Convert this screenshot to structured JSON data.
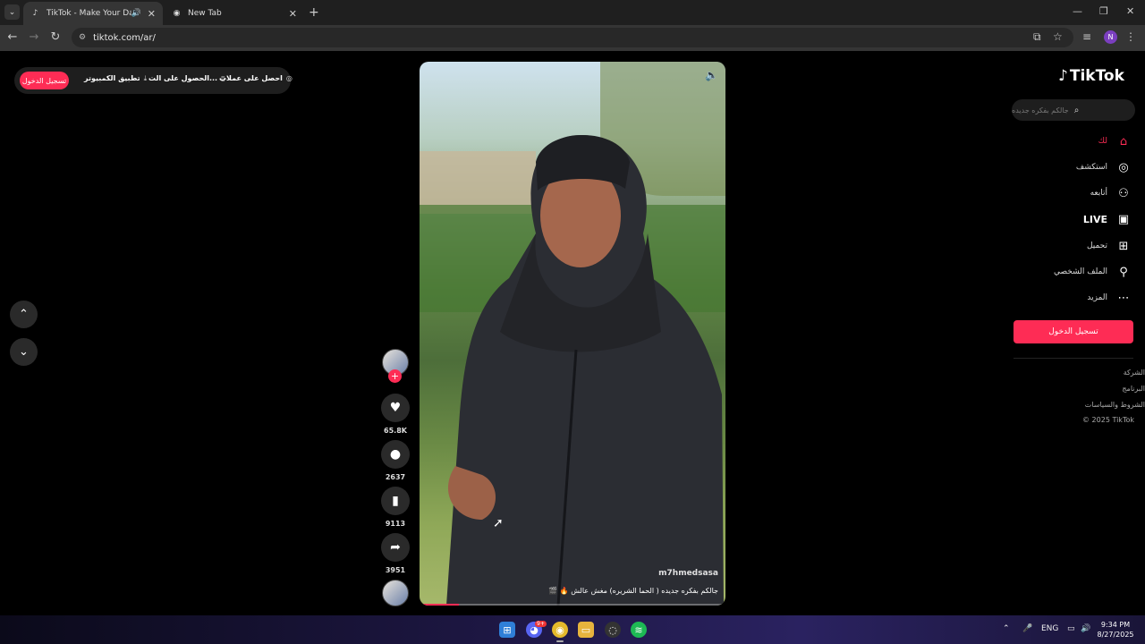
{
  "browser": {
    "tabs": [
      {
        "title": "TikTok - Make Your Day",
        "active": true
      },
      {
        "title": "New Tab",
        "active": false
      }
    ],
    "url": "tiktok.com/ar/",
    "profile_initial": "N"
  },
  "topbar": {
    "login": "تسجيل الدخول",
    "desktop_app": "تطبيق الكمبيوتر",
    "get_app": "الحصول على الت...",
    "get_coins": "احصل على عملات"
  },
  "video": {
    "watermark": "m7hmedsasa",
    "caption": "جالكم بفكره جديده ( الحما الشريره) مغش عالش 🔥 🎬",
    "progress": 0.13
  },
  "actions": {
    "likes": "65.8K",
    "comments": "2637",
    "saves": "9113",
    "shares": "3951"
  },
  "sidebar": {
    "logo": "TikTok",
    "search_placeholder": "جالكم بفكره جديده",
    "nav": {
      "home": "لك",
      "explore": "استكشف",
      "following": "أتابعه",
      "live": "LIVE",
      "upload": "تحميل",
      "profile": "الملف الشخصي",
      "more": "المزيد"
    },
    "login_button": "تسجيل الدخول",
    "footer": {
      "company": "الشركة",
      "program": "البرنامج",
      "terms": "الشروط والسياسات",
      "copyright": "© 2025 TikTok"
    }
  },
  "taskbar": {
    "discord_badge": "9+",
    "lang": "ENG",
    "time": "9:34 PM",
    "date": "8/27/2025"
  }
}
